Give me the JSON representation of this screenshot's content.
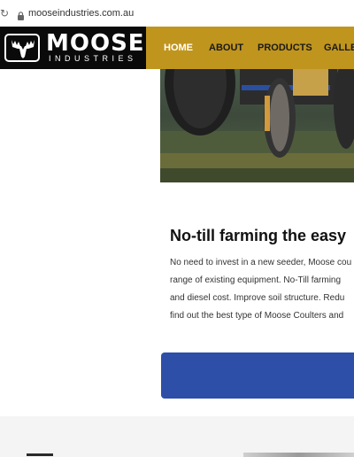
{
  "browser": {
    "url": "mooseindustries.com.au",
    "reload_glyph": "↻"
  },
  "logo": {
    "word": "MOOSE",
    "sub": "INDUSTRIES"
  },
  "nav": {
    "items": [
      {
        "label": "HOME",
        "active": true
      },
      {
        "label": "ABOUT",
        "active": false
      },
      {
        "label": "PRODUCTS",
        "active": false
      },
      {
        "label": "GALLE",
        "active": false
      }
    ]
  },
  "content": {
    "heading": "No-till farming the easy",
    "paragraph_lines": [
      "No need to invest in a new seeder, Moose cou",
      "range of existing equipment. No-Till farming",
      "and diesel cost. Improve soil structure. Redu",
      "find out the best type of Moose Coulters and"
    ]
  },
  "colors": {
    "header_gold": "#c0951e",
    "logo_black": "#0a0a0a",
    "cta_blue": "#2e4fa8"
  }
}
